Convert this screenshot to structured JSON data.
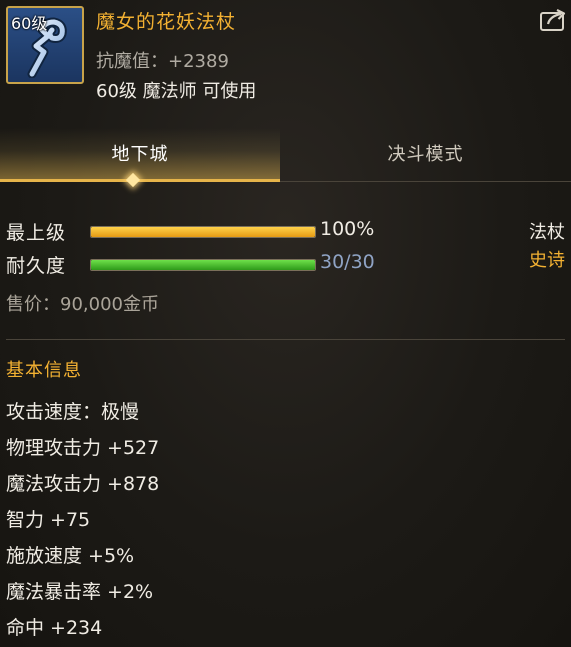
{
  "item": {
    "level_badge": "60级",
    "name": "魔女的花妖法杖",
    "stat_line": "抗魔值：+2389",
    "requirement": "60级 魔法师 可使用",
    "icon": "magic-staff-icon"
  },
  "header": {
    "share_icon": "share-icon"
  },
  "tabs": [
    {
      "label": "地下城",
      "active": true
    },
    {
      "label": "决斗模式",
      "active": false
    }
  ],
  "bars": {
    "grade": {
      "label": "最上级",
      "value_text": "100%",
      "fraction": 1.0,
      "color": "#f0a820"
    },
    "durability": {
      "label": "耐久度",
      "value_text": "30/30",
      "fraction": 1.0,
      "color": "#3fbf26"
    }
  },
  "side_tags": {
    "type": "法杖",
    "rarity": "史诗",
    "rarity_color": "#f3b132"
  },
  "price": "售价：90,000金币",
  "basic_info": {
    "title": "基本信息",
    "attributes": [
      "攻击速度：极慢",
      "物理攻击力 +527",
      "魔法攻击力 +878",
      "智力 +75",
      "施放速度 +5%",
      "魔法暴击率 +2%",
      "命中 +234"
    ]
  }
}
